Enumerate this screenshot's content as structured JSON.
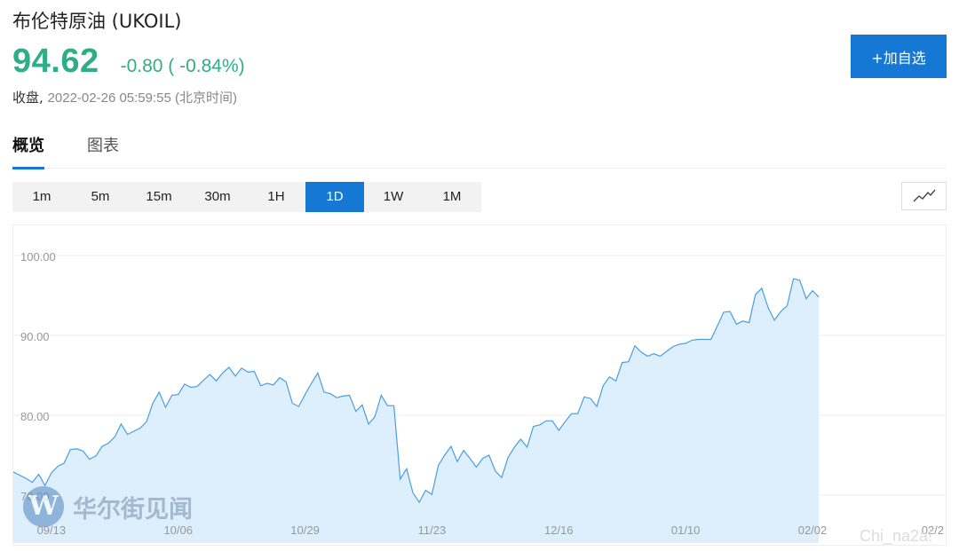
{
  "header": {
    "title": "布伦特原油 (UKOIL)",
    "price": "94.62",
    "change": "-0.80 ( -0.84%)",
    "status_label": "收盘,",
    "timestamp": "2022-02-26 05:59:55 (北京时间)",
    "add_button": "+加自选"
  },
  "tabs": [
    {
      "label": "概览",
      "active": true
    },
    {
      "label": "图表",
      "active": false
    }
  ],
  "periods": [
    {
      "label": "1m",
      "active": false
    },
    {
      "label": "5m",
      "active": false
    },
    {
      "label": "15m",
      "active": false
    },
    {
      "label": "30m",
      "active": false
    },
    {
      "label": "1H",
      "active": false
    },
    {
      "label": "1D",
      "active": true
    },
    {
      "label": "1W",
      "active": false
    },
    {
      "label": "1M",
      "active": false
    }
  ],
  "chart_type_icon": "line-chart-icon",
  "colors": {
    "accent": "#1478d4",
    "price_green": "#2fae85",
    "line": "#4a9ee0",
    "area": "#ddeefc"
  },
  "watermark": {
    "logo_letter": "W",
    "text": "华尔街见闻"
  },
  "corner_mark": "Chi_na2a!",
  "chart_data": {
    "type": "area",
    "ylim": [
      69,
      103.5
    ],
    "yticks": [
      "100.00",
      "90.00",
      "80.00",
      "70.00"
    ],
    "ytick_values": [
      100,
      90,
      80,
      70
    ],
    "xticks": [
      "09/13",
      "10/06",
      "10/29",
      "11/23",
      "12/16",
      "01/10",
      "02/02",
      "02/2"
    ],
    "xtick_index": [
      6,
      26,
      46,
      66,
      86,
      106,
      126,
      146
    ],
    "grid": true,
    "values": [
      72.9,
      72.5,
      72.1,
      71.6,
      72.6,
      71.2,
      72.8,
      73.6,
      74.0,
      75.7,
      75.8,
      75.5,
      74.5,
      74.9,
      76.1,
      76.5,
      77.3,
      78.9,
      77.6,
      78.0,
      78.4,
      79.2,
      81.5,
      82.9,
      81.0,
      82.5,
      82.6,
      83.9,
      83.5,
      83.6,
      84.4,
      85.1,
      84.3,
      85.3,
      86.0,
      84.9,
      85.9,
      85.4,
      85.5,
      83.7,
      84.0,
      83.8,
      84.7,
      84.2,
      81.5,
      81.1,
      82.6,
      84.0,
      85.3,
      82.9,
      82.7,
      82.2,
      82.4,
      82.5,
      80.5,
      81.3,
      78.9,
      79.8,
      82.5,
      81.2,
      81.2,
      72.0,
      73.3,
      70.3,
      69.1,
      70.6,
      70.1,
      73.7,
      75.0,
      76.1,
      74.2,
      75.6,
      74.6,
      73.5,
      74.6,
      75.0,
      73.0,
      72.2,
      74.7,
      76.0,
      77.0,
      76.0,
      78.6,
      78.8,
      79.3,
      79.3,
      78.1,
      79.2,
      80.2,
      80.2,
      82.3,
      82.1,
      81.1,
      83.7,
      84.8,
      84.3,
      86.6,
      86.7,
      88.7,
      87.9,
      87.4,
      87.7,
      87.4,
      88.0,
      88.6,
      88.9,
      89.0,
      89.4,
      89.5,
      89.5,
      89.5,
      91.2,
      92.9,
      93.0,
      91.4,
      91.8,
      91.6,
      95.1,
      95.9,
      93.5,
      91.9,
      93.0,
      93.7,
      97.1,
      96.9,
      94.6,
      95.6,
      94.8
    ],
    "x_span": 147
  }
}
